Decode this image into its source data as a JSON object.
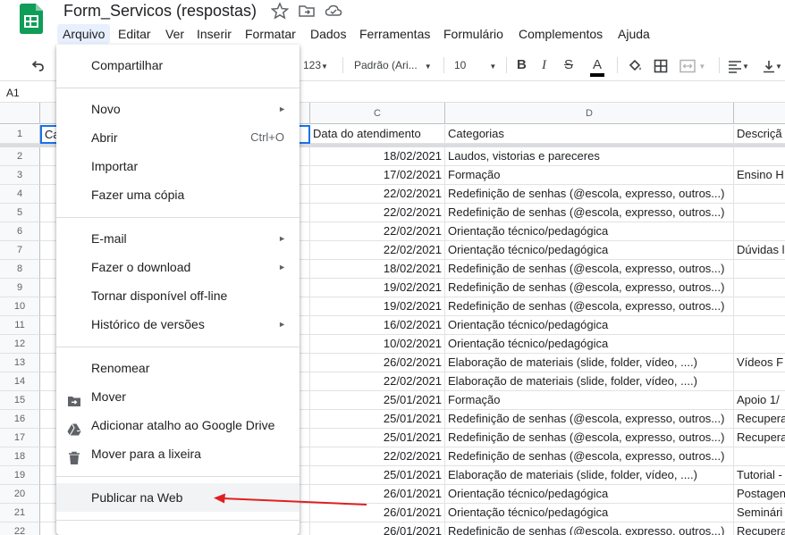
{
  "app": {
    "title": "Form_Servicos (respostas)"
  },
  "menubar": [
    "Arquivo",
    "Editar",
    "Ver",
    "Inserir",
    "Formatar",
    "Dados",
    "Ferramentas",
    "Formulário",
    "Complementos",
    "Ajuda"
  ],
  "toolbar": {
    "number_format": "123",
    "font_family": "Padrão (Ari...",
    "font_size": "10"
  },
  "namebox": "A1",
  "columns": [
    "C",
    "D"
  ],
  "header_row": {
    "a_partial": "Ca",
    "c": "Data do atendimento",
    "d": "Categorias",
    "e_partial": "Descriçã"
  },
  "rows": [
    {
      "n": "2",
      "c": "18/02/2021",
      "d": "Laudos, vistorias e pareceres",
      "e": ""
    },
    {
      "n": "3",
      "c": "17/02/2021",
      "d": "Formação",
      "e": "Ensino H"
    },
    {
      "n": "4",
      "c": "22/02/2021",
      "d": "Redefinição de senhas (@escola, expresso, outros...)",
      "e": ""
    },
    {
      "n": "5",
      "c": "22/02/2021",
      "d": "Redefinição de senhas (@escola, expresso, outros...)",
      "e": ""
    },
    {
      "n": "6",
      "c": "22/02/2021",
      "d": "Orientação técnico/pedagógica",
      "e": ""
    },
    {
      "n": "7",
      "c": "22/02/2021",
      "d": "Orientação técnico/pedagógica",
      "e": "Dúvidas l"
    },
    {
      "n": "8",
      "c": "18/02/2021",
      "d": "Redefinição de senhas (@escola, expresso, outros...)",
      "e": ""
    },
    {
      "n": "9",
      "c": "19/02/2021",
      "d": "Redefinição de senhas (@escola, expresso, outros...)",
      "e": ""
    },
    {
      "n": "10",
      "c": "19/02/2021",
      "d": "Redefinição de senhas (@escola, expresso, outros...)",
      "e": ""
    },
    {
      "n": "11",
      "c": "16/02/2021",
      "d": "Orientação técnico/pedagógica",
      "e": ""
    },
    {
      "n": "12",
      "c": "10/02/2021",
      "d": "Orientação técnico/pedagógica",
      "e": ""
    },
    {
      "n": "13",
      "c": "26/02/2021",
      "d": "Elaboração de materiais (slide, folder, vídeo, ....)",
      "e": "Vídeos F"
    },
    {
      "n": "14",
      "c": "22/02/2021",
      "d": "Elaboração de materiais (slide, folder, vídeo, ....)",
      "e": ""
    },
    {
      "n": "15",
      "c": "25/01/2021",
      "d": "Formação",
      "e": "Apoio 1/"
    },
    {
      "n": "16",
      "c": "25/01/2021",
      "d": "Redefinição de senhas (@escola, expresso, outros...)",
      "e": "Recupera"
    },
    {
      "n": "17",
      "c": "25/01/2021",
      "d": "Redefinição de senhas (@escola, expresso, outros...)",
      "e": "Recupera"
    },
    {
      "n": "18",
      "c": "22/02/2021",
      "d": "Redefinição de senhas (@escola, expresso, outros...)",
      "e": ""
    },
    {
      "n": "19",
      "c": "25/01/2021",
      "d": "Elaboração de materiais (slide, folder, vídeo, ....)",
      "e": "Tutorial -"
    },
    {
      "n": "20",
      "c": "26/01/2021",
      "d": "Orientação técnico/pedagógica",
      "e": "Postagen"
    },
    {
      "n": "21",
      "c": "26/01/2021",
      "d": "Orientação técnico/pedagógica",
      "e": "Seminári"
    },
    {
      "n": "22",
      "c": "26/01/2021",
      "d": "Redefinição de senhas (@escola, expresso, outros...)",
      "e": "Recupera"
    }
  ],
  "file_menu": {
    "share": "Compartilhar",
    "new": "Novo",
    "open": "Abrir",
    "open_shortcut": "Ctrl+O",
    "import": "Importar",
    "make_copy": "Fazer uma cópia",
    "email": "E-mail",
    "download": "Fazer o download",
    "offline": "Tornar disponível off-line",
    "version_history": "Histórico de versões",
    "rename": "Renomear",
    "move": "Mover",
    "add_shortcut": "Adicionar atalho ao Google Drive",
    "trash": "Mover para a lixeira",
    "publish": "Publicar na Web"
  },
  "colors": {
    "accent": "#1a73e8",
    "sheets_green": "#0f9d58",
    "annotation_arrow": "#e02020"
  }
}
